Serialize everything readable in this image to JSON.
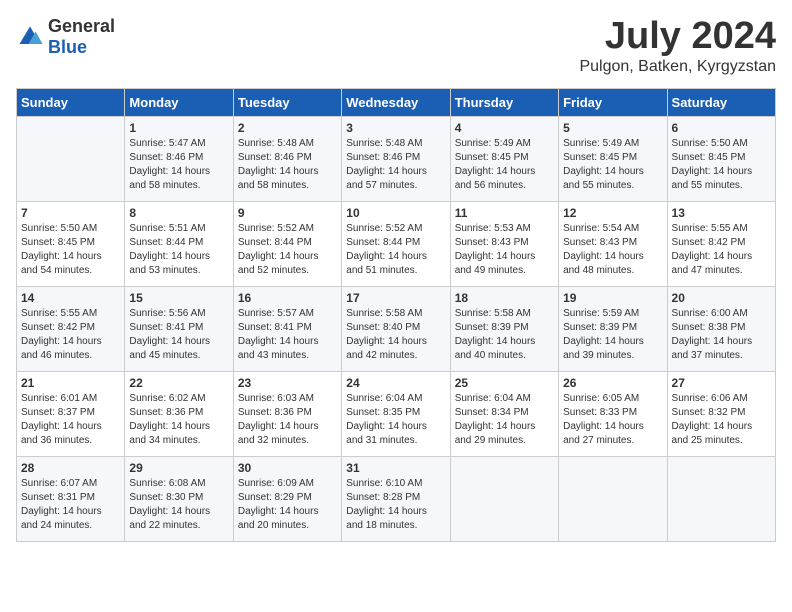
{
  "logo": {
    "text_general": "General",
    "text_blue": "Blue"
  },
  "title": {
    "month": "July 2024",
    "location": "Pulgon, Batken, Kyrgyzstan"
  },
  "headers": [
    "Sunday",
    "Monday",
    "Tuesday",
    "Wednesday",
    "Thursday",
    "Friday",
    "Saturday"
  ],
  "weeks": [
    [
      {
        "day": "",
        "sunrise": "",
        "sunset": "",
        "daylight": ""
      },
      {
        "day": "1",
        "sunrise": "Sunrise: 5:47 AM",
        "sunset": "Sunset: 8:46 PM",
        "daylight": "Daylight: 14 hours and 58 minutes."
      },
      {
        "day": "2",
        "sunrise": "Sunrise: 5:48 AM",
        "sunset": "Sunset: 8:46 PM",
        "daylight": "Daylight: 14 hours and 58 minutes."
      },
      {
        "day": "3",
        "sunrise": "Sunrise: 5:48 AM",
        "sunset": "Sunset: 8:46 PM",
        "daylight": "Daylight: 14 hours and 57 minutes."
      },
      {
        "day": "4",
        "sunrise": "Sunrise: 5:49 AM",
        "sunset": "Sunset: 8:45 PM",
        "daylight": "Daylight: 14 hours and 56 minutes."
      },
      {
        "day": "5",
        "sunrise": "Sunrise: 5:49 AM",
        "sunset": "Sunset: 8:45 PM",
        "daylight": "Daylight: 14 hours and 55 minutes."
      },
      {
        "day": "6",
        "sunrise": "Sunrise: 5:50 AM",
        "sunset": "Sunset: 8:45 PM",
        "daylight": "Daylight: 14 hours and 55 minutes."
      }
    ],
    [
      {
        "day": "7",
        "sunrise": "Sunrise: 5:50 AM",
        "sunset": "Sunset: 8:45 PM",
        "daylight": "Daylight: 14 hours and 54 minutes."
      },
      {
        "day": "8",
        "sunrise": "Sunrise: 5:51 AM",
        "sunset": "Sunset: 8:44 PM",
        "daylight": "Daylight: 14 hours and 53 minutes."
      },
      {
        "day": "9",
        "sunrise": "Sunrise: 5:52 AM",
        "sunset": "Sunset: 8:44 PM",
        "daylight": "Daylight: 14 hours and 52 minutes."
      },
      {
        "day": "10",
        "sunrise": "Sunrise: 5:52 AM",
        "sunset": "Sunset: 8:44 PM",
        "daylight": "Daylight: 14 hours and 51 minutes."
      },
      {
        "day": "11",
        "sunrise": "Sunrise: 5:53 AM",
        "sunset": "Sunset: 8:43 PM",
        "daylight": "Daylight: 14 hours and 49 minutes."
      },
      {
        "day": "12",
        "sunrise": "Sunrise: 5:54 AM",
        "sunset": "Sunset: 8:43 PM",
        "daylight": "Daylight: 14 hours and 48 minutes."
      },
      {
        "day": "13",
        "sunrise": "Sunrise: 5:55 AM",
        "sunset": "Sunset: 8:42 PM",
        "daylight": "Daylight: 14 hours and 47 minutes."
      }
    ],
    [
      {
        "day": "14",
        "sunrise": "Sunrise: 5:55 AM",
        "sunset": "Sunset: 8:42 PM",
        "daylight": "Daylight: 14 hours and 46 minutes."
      },
      {
        "day": "15",
        "sunrise": "Sunrise: 5:56 AM",
        "sunset": "Sunset: 8:41 PM",
        "daylight": "Daylight: 14 hours and 45 minutes."
      },
      {
        "day": "16",
        "sunrise": "Sunrise: 5:57 AM",
        "sunset": "Sunset: 8:41 PM",
        "daylight": "Daylight: 14 hours and 43 minutes."
      },
      {
        "day": "17",
        "sunrise": "Sunrise: 5:58 AM",
        "sunset": "Sunset: 8:40 PM",
        "daylight": "Daylight: 14 hours and 42 minutes."
      },
      {
        "day": "18",
        "sunrise": "Sunrise: 5:58 AM",
        "sunset": "Sunset: 8:39 PM",
        "daylight": "Daylight: 14 hours and 40 minutes."
      },
      {
        "day": "19",
        "sunrise": "Sunrise: 5:59 AM",
        "sunset": "Sunset: 8:39 PM",
        "daylight": "Daylight: 14 hours and 39 minutes."
      },
      {
        "day": "20",
        "sunrise": "Sunrise: 6:00 AM",
        "sunset": "Sunset: 8:38 PM",
        "daylight": "Daylight: 14 hours and 37 minutes."
      }
    ],
    [
      {
        "day": "21",
        "sunrise": "Sunrise: 6:01 AM",
        "sunset": "Sunset: 8:37 PM",
        "daylight": "Daylight: 14 hours and 36 minutes."
      },
      {
        "day": "22",
        "sunrise": "Sunrise: 6:02 AM",
        "sunset": "Sunset: 8:36 PM",
        "daylight": "Daylight: 14 hours and 34 minutes."
      },
      {
        "day": "23",
        "sunrise": "Sunrise: 6:03 AM",
        "sunset": "Sunset: 8:36 PM",
        "daylight": "Daylight: 14 hours and 32 minutes."
      },
      {
        "day": "24",
        "sunrise": "Sunrise: 6:04 AM",
        "sunset": "Sunset: 8:35 PM",
        "daylight": "Daylight: 14 hours and 31 minutes."
      },
      {
        "day": "25",
        "sunrise": "Sunrise: 6:04 AM",
        "sunset": "Sunset: 8:34 PM",
        "daylight": "Daylight: 14 hours and 29 minutes."
      },
      {
        "day": "26",
        "sunrise": "Sunrise: 6:05 AM",
        "sunset": "Sunset: 8:33 PM",
        "daylight": "Daylight: 14 hours and 27 minutes."
      },
      {
        "day": "27",
        "sunrise": "Sunrise: 6:06 AM",
        "sunset": "Sunset: 8:32 PM",
        "daylight": "Daylight: 14 hours and 25 minutes."
      }
    ],
    [
      {
        "day": "28",
        "sunrise": "Sunrise: 6:07 AM",
        "sunset": "Sunset: 8:31 PM",
        "daylight": "Daylight: 14 hours and 24 minutes."
      },
      {
        "day": "29",
        "sunrise": "Sunrise: 6:08 AM",
        "sunset": "Sunset: 8:30 PM",
        "daylight": "Daylight: 14 hours and 22 minutes."
      },
      {
        "day": "30",
        "sunrise": "Sunrise: 6:09 AM",
        "sunset": "Sunset: 8:29 PM",
        "daylight": "Daylight: 14 hours and 20 minutes."
      },
      {
        "day": "31",
        "sunrise": "Sunrise: 6:10 AM",
        "sunset": "Sunset: 8:28 PM",
        "daylight": "Daylight: 14 hours and 18 minutes."
      },
      {
        "day": "",
        "sunrise": "",
        "sunset": "",
        "daylight": ""
      },
      {
        "day": "",
        "sunrise": "",
        "sunset": "",
        "daylight": ""
      },
      {
        "day": "",
        "sunrise": "",
        "sunset": "",
        "daylight": ""
      }
    ]
  ]
}
